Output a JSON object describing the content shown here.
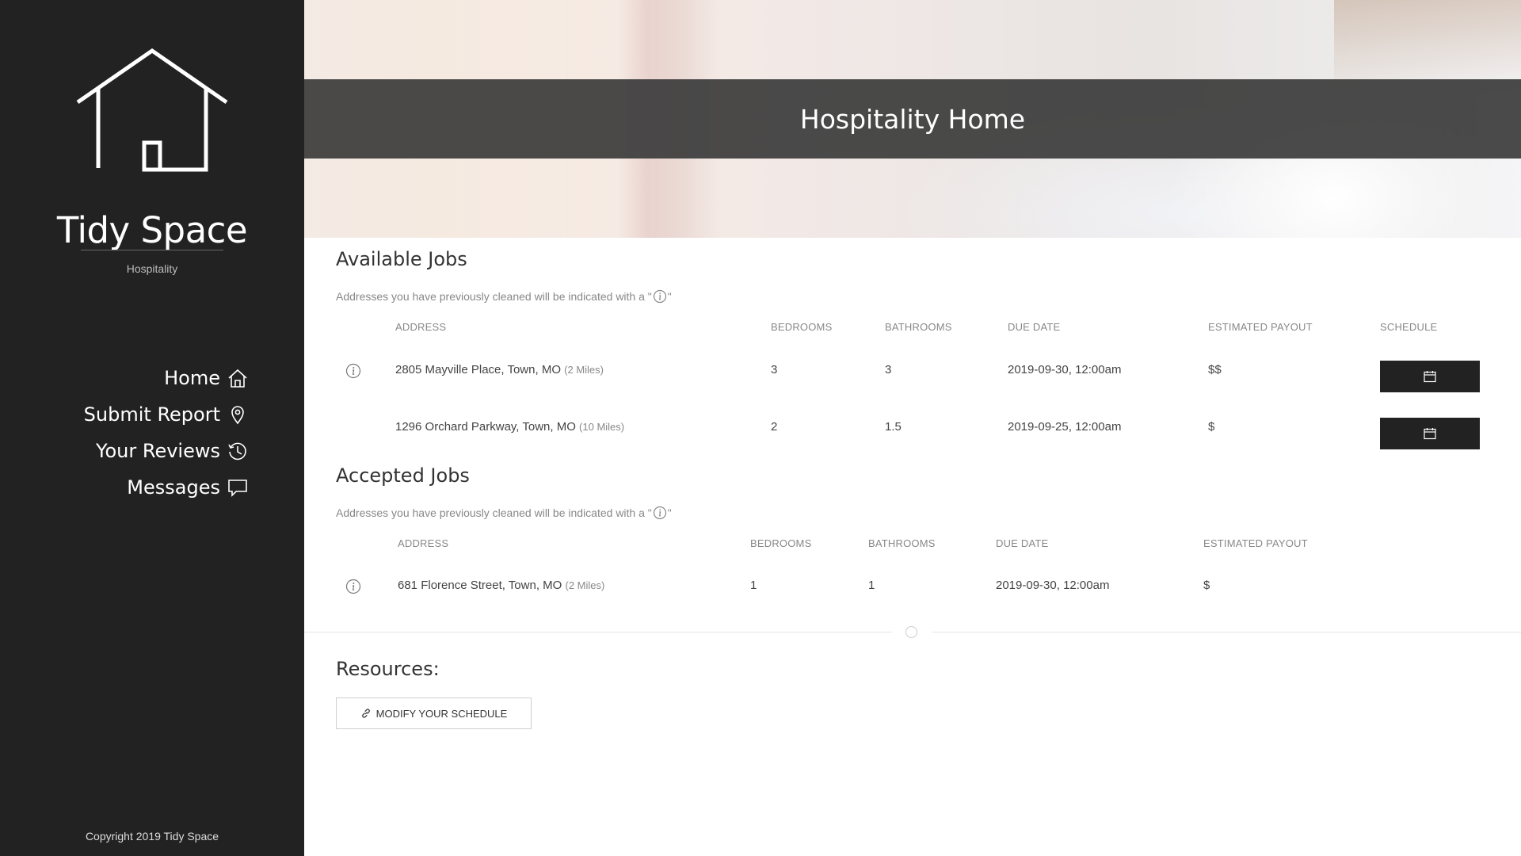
{
  "sidebar": {
    "brand_title": "Tidy Space",
    "brand_subtitle": "Hospitality",
    "nav": [
      {
        "label": "Home",
        "icon": "home-icon"
      },
      {
        "label": "Submit Report",
        "icon": "map-pin-icon"
      },
      {
        "label": "Your Reviews",
        "icon": "history-icon"
      },
      {
        "label": "Messages",
        "icon": "chat-icon"
      }
    ],
    "copyright": "Copyright 2019 Tidy Space"
  },
  "hero": {
    "title": "Hospitality Home"
  },
  "available": {
    "title": "Available Jobs",
    "note_before": "Addresses you have previously cleaned will be indicated with a \"",
    "note_after": "\"",
    "headers": {
      "address": "Address",
      "bedrooms": "Bedrooms",
      "bathrooms": "Bathrooms",
      "due_date": "Due Date",
      "payout": "Estimated Payout",
      "schedule": "Schedule"
    },
    "rows": [
      {
        "address": "2805 Mayville Place, Town, MO",
        "distance": "(2 Miles)",
        "bedrooms": "3",
        "bathrooms": "3",
        "due_date": "2019-09-30, 12:00am",
        "payout": "$$",
        "previously_cleaned": true
      },
      {
        "address": "1296 Orchard Parkway, Town, MO",
        "distance": "(10 Miles)",
        "bedrooms": "2",
        "bathrooms": "1.5",
        "due_date": "2019-09-25, 12:00am",
        "payout": "$",
        "previously_cleaned": false
      }
    ]
  },
  "accepted": {
    "title": "Accepted Jobs",
    "note_before": "Addresses you have previously cleaned will be indicated with a \"",
    "note_after": "\"",
    "headers": {
      "address": "Address",
      "bedrooms": "Bedrooms",
      "bathrooms": "Bathrooms",
      "due_date": "Due Date",
      "payout": "Estimated Payout"
    },
    "rows": [
      {
        "address": "681 Florence Street, Town, MO",
        "distance": "(2 Miles)",
        "bedrooms": "1",
        "bathrooms": "1",
        "due_date": "2019-09-30, 12:00am",
        "payout": "$",
        "previously_cleaned": true
      }
    ]
  },
  "resources": {
    "title": "Resources:",
    "button_label": "Modify Your Schedule",
    "button_icon": "link-icon"
  },
  "colors": {
    "sidebar_bg": "#222222",
    "band_bg": "#3c3c3c",
    "button_bg": "#222222"
  }
}
